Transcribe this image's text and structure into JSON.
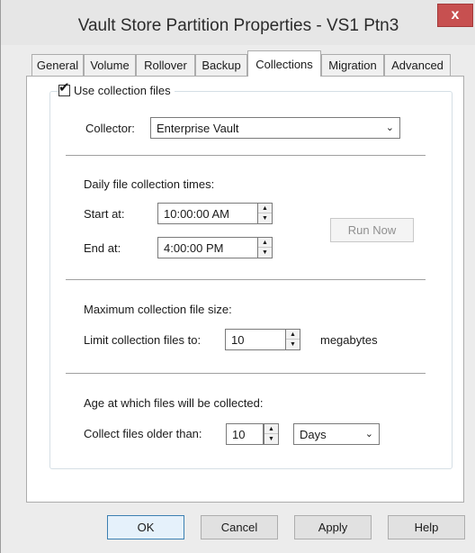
{
  "window": {
    "title": "Vault Store Partition Properties - VS1 Ptn3",
    "close_glyph": "x"
  },
  "tabs": [
    {
      "label": "General"
    },
    {
      "label": "Volume"
    },
    {
      "label": "Rollover"
    },
    {
      "label": "Backup"
    },
    {
      "label": "Collections",
      "active": true
    },
    {
      "label": "Migration"
    },
    {
      "label": "Advanced"
    }
  ],
  "collections": {
    "use_collection_files_label": "Use collection files",
    "use_collection_files_checked": true,
    "collector_label": "Collector:",
    "collector_value": "Enterprise Vault",
    "daily_heading": "Daily file collection times:",
    "start_label": "Start at:",
    "start_value": "10:00:00 AM",
    "end_label": "End at:",
    "end_value": "4:00:00 PM",
    "run_now_label": "Run Now",
    "max_size_heading": "Maximum collection file size:",
    "limit_label": "Limit collection files to:",
    "limit_value": "10",
    "limit_unit": "megabytes",
    "age_heading": "Age at which files will be collected:",
    "older_label": "Collect files older than:",
    "older_value": "10",
    "older_unit_value": "Days"
  },
  "footer": {
    "ok_label": "OK",
    "cancel_label": "Cancel",
    "apply_label": "Apply",
    "help_label": "Help"
  },
  "icons": {
    "dropdown": "chevron-down-icon",
    "spin_up": "triangle-up-icon",
    "spin_down": "triangle-down-icon",
    "check": "checkmark-icon"
  },
  "colors": {
    "close_button": "#c75050",
    "dialog_background": "#ececec",
    "panel_background": "#ffffff"
  }
}
